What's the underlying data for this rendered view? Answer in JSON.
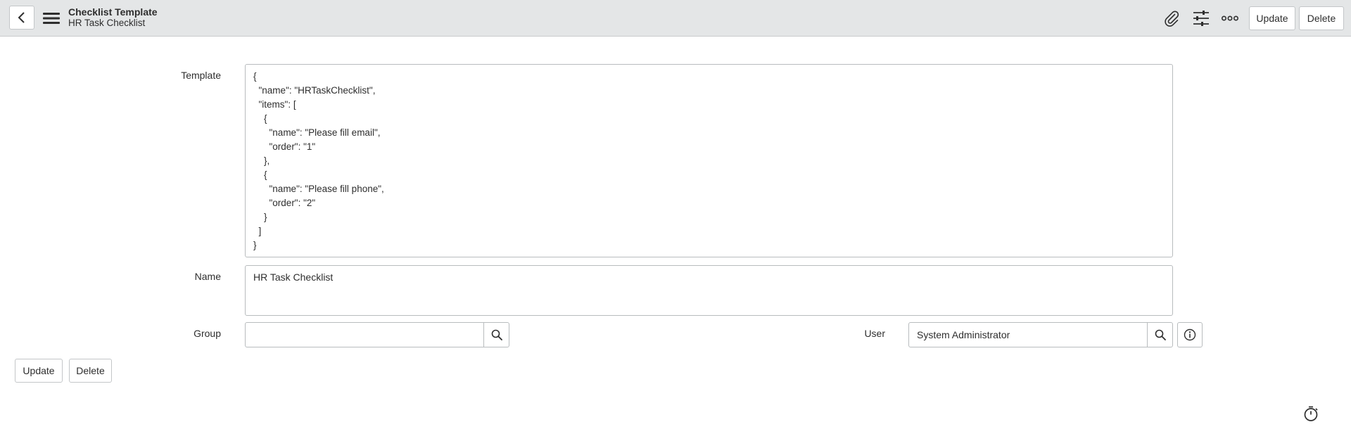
{
  "header": {
    "back_icon": "chevron-left-icon",
    "menu_icon": "hamburger-icon",
    "title": "Checklist Template",
    "subtitle": "HR Task Checklist",
    "attachment_icon": "paperclip-icon",
    "personalize_icon": "sliders-icon",
    "more_icon": "more-options-icon",
    "update_label": "Update",
    "delete_label": "Delete"
  },
  "form": {
    "template_label": "Template",
    "template_value": "{\n  \"name\": \"HRTaskChecklist\",\n  \"items\": [\n    {\n      \"name\": \"Please fill email\",\n      \"order\": \"1\"\n    },\n    {\n      \"name\": \"Please fill phone\",\n      \"order\": \"2\"\n    }\n  ]\n}",
    "name_label": "Name",
    "name_value": "HR Task Checklist",
    "group_label": "Group",
    "group_value": "",
    "user_label": "User",
    "user_value": "System Administrator",
    "search_icon": "search-icon",
    "info_icon": "info-icon"
  },
  "footer": {
    "update_label": "Update",
    "delete_label": "Delete",
    "timer_icon": "stopwatch-icon"
  }
}
